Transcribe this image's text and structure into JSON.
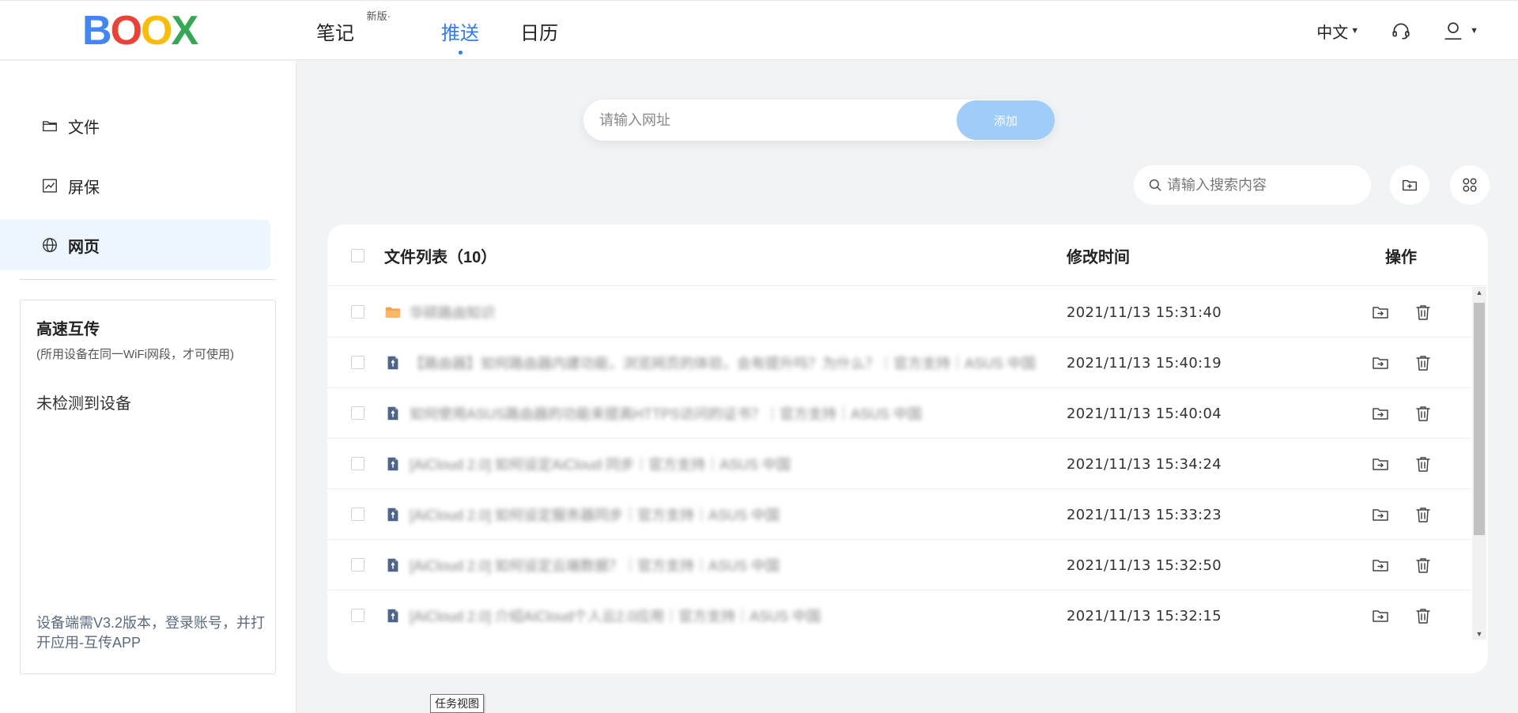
{
  "header": {
    "logo": [
      "B",
      "O",
      "O",
      "X"
    ],
    "nav": [
      {
        "label": "笔记",
        "badge": "新版·"
      },
      {
        "label": "推送"
      },
      {
        "label": "日历"
      }
    ],
    "language": "中文",
    "icons": [
      "headset-icon",
      "user-icon"
    ]
  },
  "sidebar": {
    "items": [
      {
        "label": "文件",
        "icon": "folder-icon"
      },
      {
        "label": "屏保",
        "icon": "chart-icon"
      },
      {
        "label": "网页",
        "icon": "globe-icon"
      }
    ],
    "transfer": {
      "title": "高速互传",
      "subtitle": "(所用设备在同一WiFi网段，才可使用)",
      "status": "未检测到设备",
      "note": "设备端需V3.2版本，登录账号，并打开应用-互传APP"
    }
  },
  "url_bar": {
    "placeholder": "请输入网址",
    "button": "添加"
  },
  "search": {
    "placeholder": "请输入搜索内容"
  },
  "table": {
    "headers": {
      "name": "文件列表（10）",
      "time": "修改时间",
      "ops": "操作"
    },
    "rows": [
      {
        "type": "folder",
        "name": "华硕路由知识",
        "time": "2021/11/13 15:31:40"
      },
      {
        "type": "file",
        "name": "【路由器】如何路由器内建功能，浏览网页的体验，会有提升吗？为什么？｜官方支持｜ASUS 中国",
        "time": "2021/11/13 15:40:19"
      },
      {
        "type": "file",
        "name": "如何使用ASUS路由器的功能来提高HTTPS访问的证书？｜官方支持｜ASUS 中国",
        "time": "2021/11/13 15:40:04"
      },
      {
        "type": "file",
        "name": "[AiCloud 2.0] 如何设定AiCloud 同步｜官方支持｜ASUS 中国",
        "time": "2021/11/13 15:34:24"
      },
      {
        "type": "file",
        "name": "[AiCloud 2.0] 如何设定服务器同步｜官方支持｜ASUS 中国",
        "time": "2021/11/13 15:33:23"
      },
      {
        "type": "file",
        "name": "[AiCloud 2.0] 如何设定云端数据？｜官方支持｜ASUS 中国",
        "time": "2021/11/13 15:32:50"
      },
      {
        "type": "file",
        "name": "[AiCloud 2.0] 介绍AiCloud个人云2.0应用｜官方支持｜ASUS 中国",
        "time": "2021/11/13 15:32:15"
      }
    ]
  },
  "tooltip": "任务视图",
  "colors": {
    "accent": "#2f7bf6",
    "add_button": "#9fccf8",
    "sidebar_active": "#eef6fd",
    "folder": "#f7a14c",
    "file": "#4e6488"
  }
}
